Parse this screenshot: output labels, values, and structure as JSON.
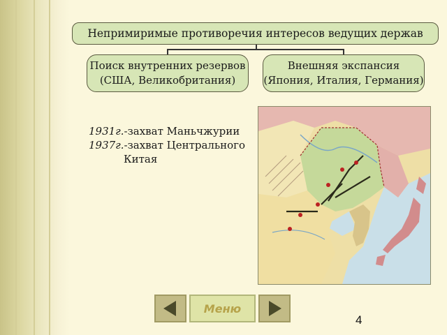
{
  "diagram": {
    "main": "Непримиримые противоречия интересов ведущих держав",
    "left_line1": "Поиск внутренних резервов",
    "left_line2": "(США, Великобритания)",
    "right_line1": "Внешняя экспансия",
    "right_line2": "(Япония, Италия, Германия)"
  },
  "events": {
    "e1_year": "1931г.",
    "e1_text": "-захват Маньчжурии",
    "e2_year": "1937г.",
    "e2_text": "-захват Центрального",
    "e2_text2": "Китая"
  },
  "nav": {
    "menu_label": "Меню",
    "prev_icon": "triangle-left-icon",
    "next_icon": "triangle-right-icon"
  },
  "page_number": "4",
  "colors": {
    "box_fill": "#d7e6b6",
    "background": "#fbf7dc",
    "button_fill": "#c2bb86",
    "arrow_dark": "#4a4a2a",
    "menu_text": "#b6a34a"
  }
}
